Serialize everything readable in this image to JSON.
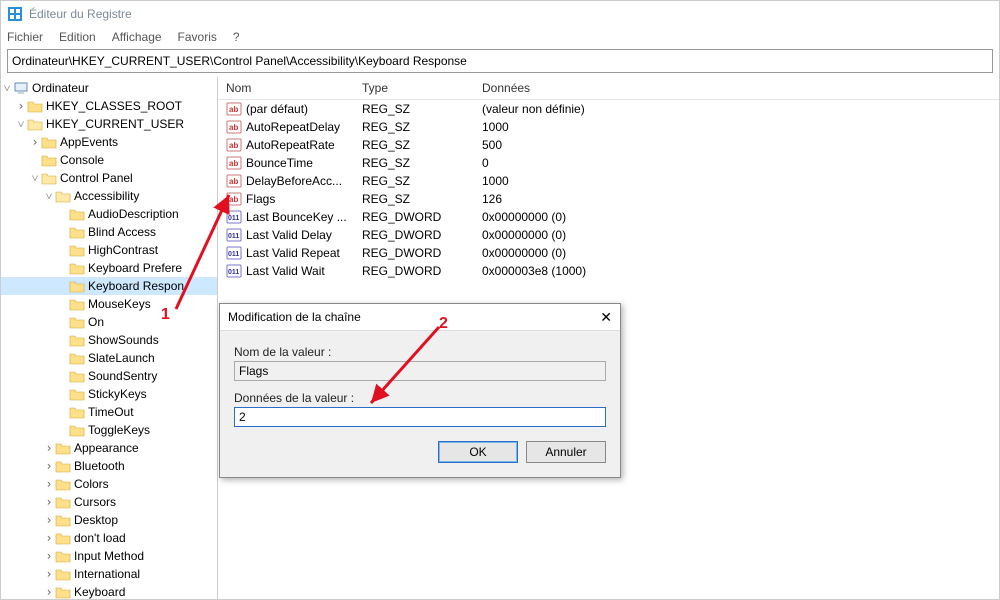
{
  "title": "Éditeur du Registre",
  "menu": {
    "file": "Fichier",
    "edit": "Edition",
    "view": "Affichage",
    "fav": "Favoris",
    "help": "?"
  },
  "address": "Ordinateur\\HKEY_CURRENT_USER\\Control Panel\\Accessibility\\Keyboard Response",
  "tree": {
    "root": "Ordinateur",
    "hkcr": "HKEY_CLASSES_ROOT",
    "hkcu": "HKEY_CURRENT_USER",
    "appevents": "AppEvents",
    "console": "Console",
    "controlpanel": "Control Panel",
    "accessibility": "Accessibility",
    "acc_items": [
      "AudioDescription",
      "Blind Access",
      "HighContrast",
      "Keyboard Prefere",
      "Keyboard Respon",
      "MouseKeys",
      "On",
      "ShowSounds",
      "SlateLaunch",
      "SoundSentry",
      "StickyKeys",
      "TimeOut",
      "ToggleKeys"
    ],
    "rest": [
      "Appearance",
      "Bluetooth",
      "Colors",
      "Cursors",
      "Desktop",
      "don't load",
      "Input Method",
      "International",
      "Keyboard"
    ]
  },
  "cols": {
    "name": "Nom",
    "type": "Type",
    "data": "Données"
  },
  "values": [
    {
      "icon": "sz",
      "name": "(par défaut)",
      "type": "REG_SZ",
      "data": "(valeur non définie)"
    },
    {
      "icon": "sz",
      "name": "AutoRepeatDelay",
      "type": "REG_SZ",
      "data": "1000"
    },
    {
      "icon": "sz",
      "name": "AutoRepeatRate",
      "type": "REG_SZ",
      "data": "500"
    },
    {
      "icon": "sz",
      "name": "BounceTime",
      "type": "REG_SZ",
      "data": "0"
    },
    {
      "icon": "sz",
      "name": "DelayBeforeAcc...",
      "type": "REG_SZ",
      "data": "1000"
    },
    {
      "icon": "sz",
      "name": "Flags",
      "type": "REG_SZ",
      "data": "126"
    },
    {
      "icon": "dw",
      "name": "Last BounceKey ...",
      "type": "REG_DWORD",
      "data": "0x00000000 (0)"
    },
    {
      "icon": "dw",
      "name": "Last Valid Delay",
      "type": "REG_DWORD",
      "data": "0x00000000 (0)"
    },
    {
      "icon": "dw",
      "name": "Last Valid Repeat",
      "type": "REG_DWORD",
      "data": "0x00000000 (0)"
    },
    {
      "icon": "dw",
      "name": "Last Valid Wait",
      "type": "REG_DWORD",
      "data": "0x000003e8 (1000)"
    }
  ],
  "dialog": {
    "title": "Modification de la chaîne",
    "lbl_name": "Nom de la valeur :",
    "val_name": "Flags",
    "lbl_data": "Données de la valeur :",
    "val_data": "2",
    "ok": "OK",
    "cancel": "Annuler"
  },
  "annotations": {
    "one": "1",
    "two": "2"
  }
}
